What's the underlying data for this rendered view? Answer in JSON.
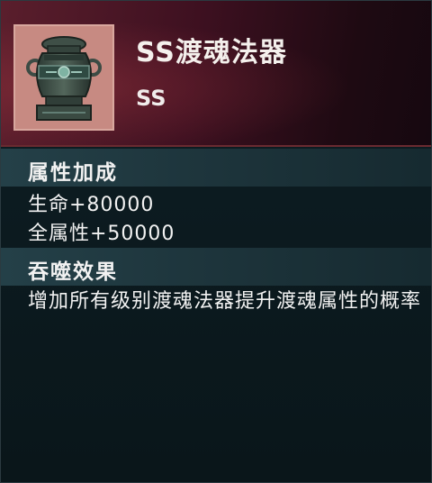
{
  "item": {
    "name": "SS渡魂法器",
    "grade": "SS",
    "icon": "urn-icon"
  },
  "sections": {
    "attributes": {
      "title": "属性加成",
      "lines": [
        "生命+80000",
        "全属性+50000"
      ]
    },
    "devour": {
      "title": "吞噬效果",
      "description": "增加所有级别渡魂法器提升渡魂属性的概率"
    }
  },
  "colors": {
    "header_red": "#5a1e2c",
    "icon_bg": "#c78a82",
    "section_bar": "#244048",
    "panel_bg": "#0c1b20"
  }
}
